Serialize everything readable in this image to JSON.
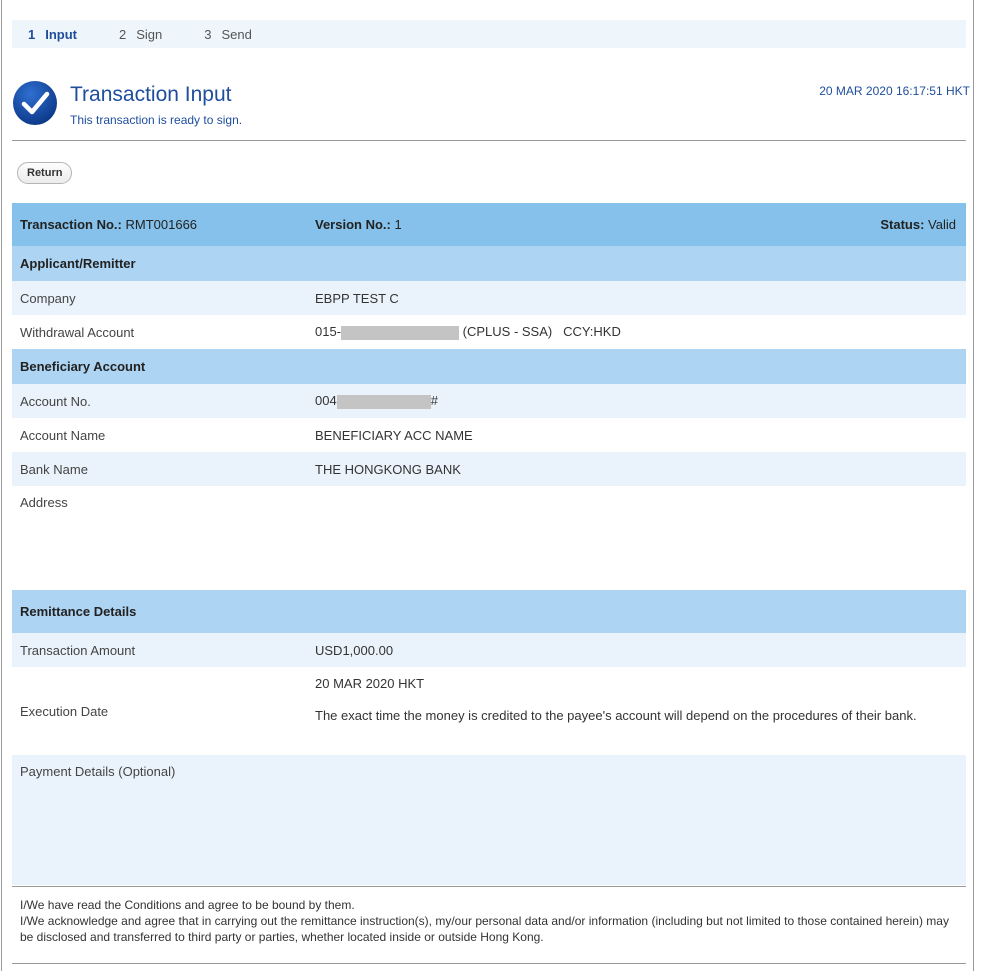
{
  "steps": [
    {
      "num": "1",
      "label": "Input"
    },
    {
      "num": "2",
      "label": "Sign"
    },
    {
      "num": "3",
      "label": "Send"
    }
  ],
  "header": {
    "title": "Transaction Input",
    "subtitle": "This transaction is ready to sign.",
    "timestamp": "20 MAR 2020 16:17:51 HKT"
  },
  "return_label": "Return",
  "summary": {
    "txn_label": "Transaction No.:",
    "txn_value": "RMT001666",
    "version_label": "Version No.:",
    "version_value": "1",
    "status_label": "Status:",
    "status_value": "Valid"
  },
  "applicant": {
    "section_title": "Applicant/Remitter",
    "company_label": "Company",
    "company_value": "EBPP TEST C",
    "withdrawal_label": "Withdrawal Account",
    "withdrawal_prefix": "015-",
    "withdrawal_suffix": "(CPLUS - SSA)   CCY:HKD"
  },
  "beneficiary": {
    "section_title": "Beneficiary Account",
    "account_no_label": "Account No.",
    "account_no_prefix": "004",
    "account_no_suffix": "#",
    "account_name_label": "Account Name",
    "account_name_value": "BENEFICIARY ACC NAME",
    "bank_name_label": "Bank Name",
    "bank_name_value": "THE HONGKONG BANK",
    "address_label": "Address"
  },
  "remittance": {
    "section_title": "Remittance Details",
    "amount_label": "Transaction Amount",
    "amount_value": "USD1,000.00",
    "exec_label": "Execution Date",
    "exec_date": "20 MAR 2020 HKT",
    "exec_note": "The exact time the money is credited to the payee's account will depend on the procedures of their bank.",
    "payment_label": "Payment Details (Optional)"
  },
  "terms": {
    "line1": "I/We have read the Conditions and agree to be bound by them.",
    "line2": "I/We acknowledge and agree that in carrying out the remittance instruction(s), my/our personal data and/or information (including but not limited to those contained herein) may be disclosed and transferred to third party or parties, whether located inside or outside Hong Kong."
  },
  "colors": {
    "accent": "#1f4e9c",
    "main_header_bg": "#85c1ea",
    "section_header_bg": "#add4f2",
    "row_alt_bg": "#eaf3fb"
  }
}
